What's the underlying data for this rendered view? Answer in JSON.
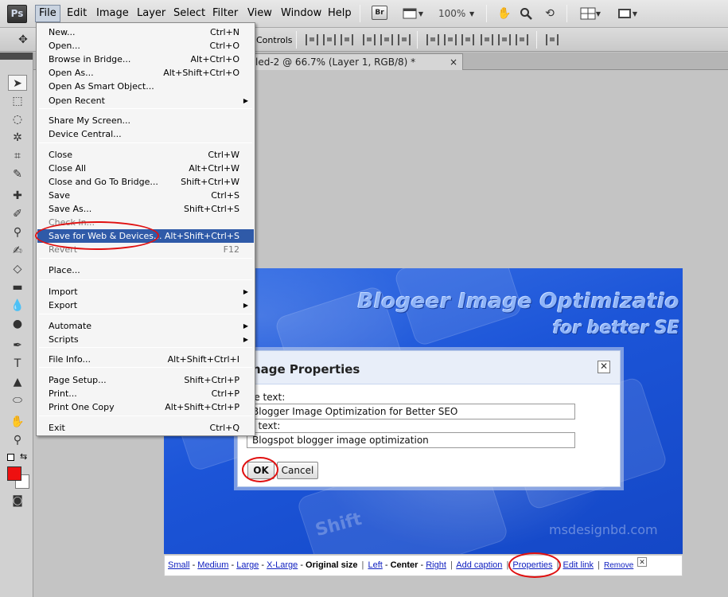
{
  "menubar": {
    "app_logo": "Ps",
    "items": [
      "File",
      "Edit",
      "Image",
      "Layer",
      "Select",
      "Filter",
      "View",
      "Window",
      "Help"
    ],
    "bridge_icon_label": "Br",
    "zoom": "100%"
  },
  "options_bar": {
    "controls_label": "Controls"
  },
  "document_tab": {
    "title": "led-2 @ 66.7% (Layer 1, RGB/8) *",
    "close": "×"
  },
  "file_menu": {
    "groups": [
      [
        {
          "label": "New...",
          "shortcut": "Ctrl+N"
        },
        {
          "label": "Open...",
          "shortcut": "Ctrl+O"
        },
        {
          "label": "Browse in Bridge...",
          "shortcut": "Alt+Ctrl+O"
        },
        {
          "label": "Open As...",
          "shortcut": "Alt+Shift+Ctrl+O"
        },
        {
          "label": "Open As Smart Object...",
          "shortcut": ""
        },
        {
          "label": "Open Recent",
          "shortcut": "",
          "submenu": true
        }
      ],
      [
        {
          "label": "Share My Screen...",
          "shortcut": ""
        },
        {
          "label": "Device Central...",
          "shortcut": ""
        }
      ],
      [
        {
          "label": "Close",
          "shortcut": "Ctrl+W"
        },
        {
          "label": "Close All",
          "shortcut": "Alt+Ctrl+W"
        },
        {
          "label": "Close and Go To Bridge...",
          "shortcut": "Shift+Ctrl+W"
        },
        {
          "label": "Save",
          "shortcut": "Ctrl+S"
        },
        {
          "label": "Save As...",
          "shortcut": "Shift+Ctrl+S"
        },
        {
          "label": "Check In...",
          "shortcut": "",
          "disabled": true
        },
        {
          "label": "Save for Web & Devices...",
          "shortcut": "Alt+Shift+Ctrl+S",
          "highlighted": true
        },
        {
          "label": "Revert",
          "shortcut": "F12",
          "disabled": true
        }
      ],
      [
        {
          "label": "Place...",
          "shortcut": ""
        }
      ],
      [
        {
          "label": "Import",
          "shortcut": "",
          "submenu": true
        },
        {
          "label": "Export",
          "shortcut": "",
          "submenu": true
        }
      ],
      [
        {
          "label": "Automate",
          "shortcut": "",
          "submenu": true
        },
        {
          "label": "Scripts",
          "shortcut": "",
          "submenu": true
        }
      ],
      [
        {
          "label": "File Info...",
          "shortcut": "Alt+Shift+Ctrl+I"
        }
      ],
      [
        {
          "label": "Page Setup...",
          "shortcut": "Shift+Ctrl+P"
        },
        {
          "label": "Print...",
          "shortcut": "Ctrl+P"
        },
        {
          "label": "Print One Copy",
          "shortcut": "Alt+Shift+Ctrl+P"
        }
      ],
      [
        {
          "label": "Exit",
          "shortcut": "Ctrl+Q"
        }
      ]
    ]
  },
  "canvas_image": {
    "banner_title": "Blogeer Image Optimizatio",
    "banner_subtitle": "for better SE",
    "watermark": "msdesignbd.com",
    "key_text": "Shift"
  },
  "dialog": {
    "title": "nage Properties",
    "close": "✕",
    "title_text_label": "le text:",
    "title_text_value": "Blogger Image Optimization for Better SEO",
    "alt_text_label": "t text:",
    "alt_text_value": "Blogspot blogger image optimization",
    "ok_label": "OK",
    "cancel_label": "Cancel"
  },
  "image_toolbar": {
    "sizes": [
      "Small",
      "Medium",
      "Large",
      "X-Large"
    ],
    "current_size": "Original size",
    "align_left": "Left",
    "current_align": "Center",
    "align_right": "Right",
    "add_caption": "Add caption",
    "properties": "Properties",
    "edit_link": "Edit link",
    "remove": "Remove",
    "close": "✕"
  },
  "colors": {
    "foreground": "#ee1010",
    "background": "#ffffff",
    "menu_highlight": "#2f5aa8",
    "annotation": "#e01010"
  }
}
